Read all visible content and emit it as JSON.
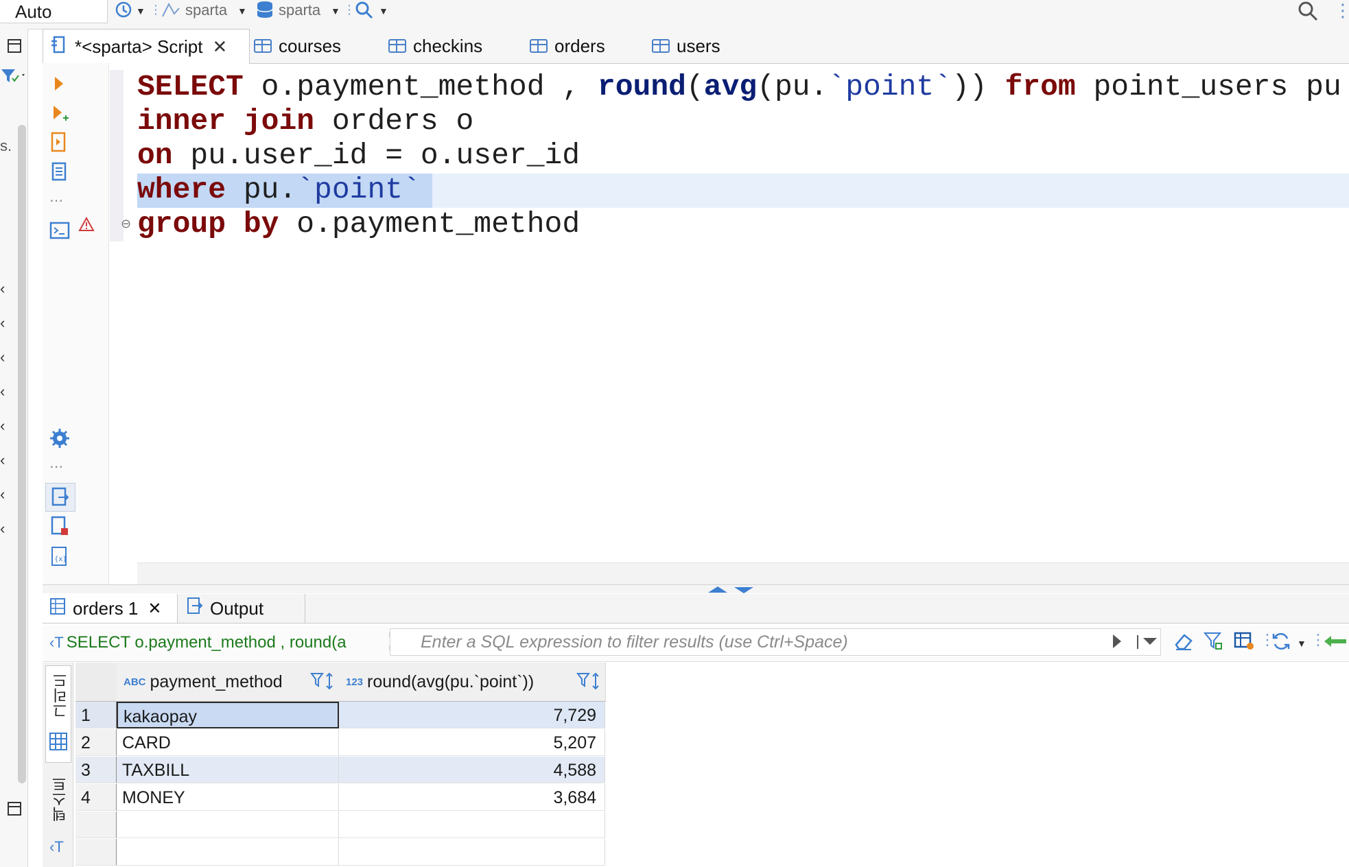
{
  "toolbar": {
    "mode": "Auto",
    "connection": "sparta",
    "database": "sparta"
  },
  "editor_tabs": [
    {
      "label": "*<sparta> Script",
      "active": true
    },
    {
      "label": "courses"
    },
    {
      "label": "checkins"
    },
    {
      "label": "orders"
    },
    {
      "label": "users"
    }
  ],
  "code": {
    "line1": {
      "kw1": "SELECT",
      "t1": " o.payment_method , ",
      "fn1": "round",
      "t2": "(",
      "fn2": "avg",
      "t3": "(pu.",
      "str1": "`point`",
      "t4": ")) ",
      "kw2": "from",
      "t5": " point_users pu"
    },
    "line2": {
      "kw1": "inner",
      "t1": " ",
      "kw2": "join",
      "t2": " orders o"
    },
    "line3": {
      "kw1": "on",
      "t1": " pu.user_id = o.user_id"
    },
    "line4": {
      "kw1": "where",
      "t1": " pu.",
      "str1": "`point`"
    },
    "line5": {
      "kw1": "group",
      "t1": " ",
      "kw2": "by",
      "t2": " o.payment_method"
    }
  },
  "result_tabs": [
    {
      "label": "orders 1",
      "active": true
    },
    {
      "label": "Output"
    }
  ],
  "filter": {
    "sql_preview": "SELECT o.payment_method , round(a",
    "placeholder": "Enter a SQL expression to filter results (use Ctrl+Space)"
  },
  "side_tabs": {
    "grid": "그리드",
    "text": "텍스트"
  },
  "grid": {
    "columns": [
      {
        "type_badge": "ABC",
        "name": "payment_method"
      },
      {
        "type_badge": "123",
        "name": "round(avg(pu.`point`))"
      }
    ],
    "rows": [
      {
        "num": "1",
        "payment_method": "kakaopay",
        "value": "7,729"
      },
      {
        "num": "2",
        "payment_method": "CARD",
        "value": "5,207"
      },
      {
        "num": "3",
        "payment_method": "TAXBILL",
        "value": "4,588"
      },
      {
        "num": "4",
        "payment_method": "MONEY",
        "value": "3,684"
      }
    ]
  },
  "colors": {
    "keyword": "#7b0a0a",
    "function": "#0a1e73",
    "string": "#1e3aa0",
    "selection": "#c2d8f5",
    "current_line": "#e8f0fc"
  }
}
